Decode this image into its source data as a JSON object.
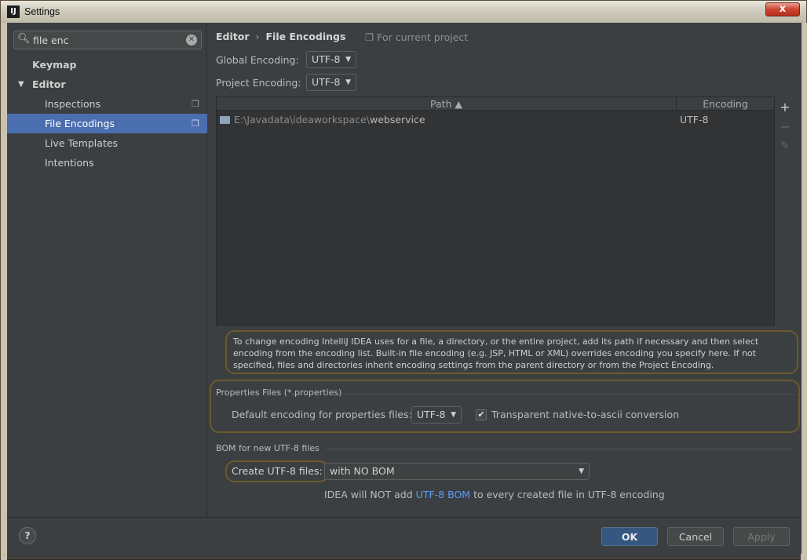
{
  "window": {
    "title": "Settings",
    "app_icon_glyph": "IJ",
    "close_glyph": "x"
  },
  "sidebar": {
    "search_value": "file enc",
    "items": [
      {
        "label": "Keymap"
      },
      {
        "label": "Editor"
      },
      {
        "label": "Inspections"
      },
      {
        "label": "File Encodings"
      },
      {
        "label": "Live Templates"
      },
      {
        "label": "Intentions"
      }
    ]
  },
  "content": {
    "breadcrumb": {
      "parent": "Editor",
      "current": "File Encodings"
    },
    "scope": "For current project",
    "global_encoding": {
      "label": "Global Encoding:",
      "value": "UTF-8"
    },
    "project_encoding": {
      "label": "Project Encoding:",
      "value": "UTF-8"
    },
    "table": {
      "columns": [
        "Path ▲",
        "Encoding"
      ],
      "rows": [
        {
          "path_prefix": "E:\\Javadata\\ideaworkspace\\",
          "path_name": "webservice",
          "encoding": "UTF-8"
        }
      ]
    },
    "hint": "To change encoding IntelliJ IDEA uses for a file, a directory, or the entire project, add its path if necessary and then select encoding from the encoding list. Built-in file encoding (e.g. JSP, HTML or XML) overrides encoding you specify here. If not specified, files and directories inherit encoding settings from the parent directory or from the Project Encoding.",
    "properties": {
      "group_title": "Properties Files (*.properties)",
      "default_label": "Default encoding for properties files:",
      "default_value": "UTF-8",
      "transparent_label": "Transparent native-to-ascii conversion",
      "transparent_checked": true
    },
    "bom": {
      "group_title": "BOM for new UTF-8 files",
      "create_label": "Create UTF-8 files:",
      "create_value": "with NO BOM",
      "note_before": "IDEA will NOT add",
      "note_link": "UTF-8 BOM",
      "note_after": "to every created file in UTF-8 encoding"
    }
  },
  "footer": {
    "ok": "OK",
    "cancel": "Cancel",
    "apply": "Apply",
    "help": "?"
  },
  "colors": {
    "accent": "#4b6eaf",
    "primary_button": "#365880",
    "link": "#589df6",
    "highlight_outline": "#6b5a2c"
  }
}
